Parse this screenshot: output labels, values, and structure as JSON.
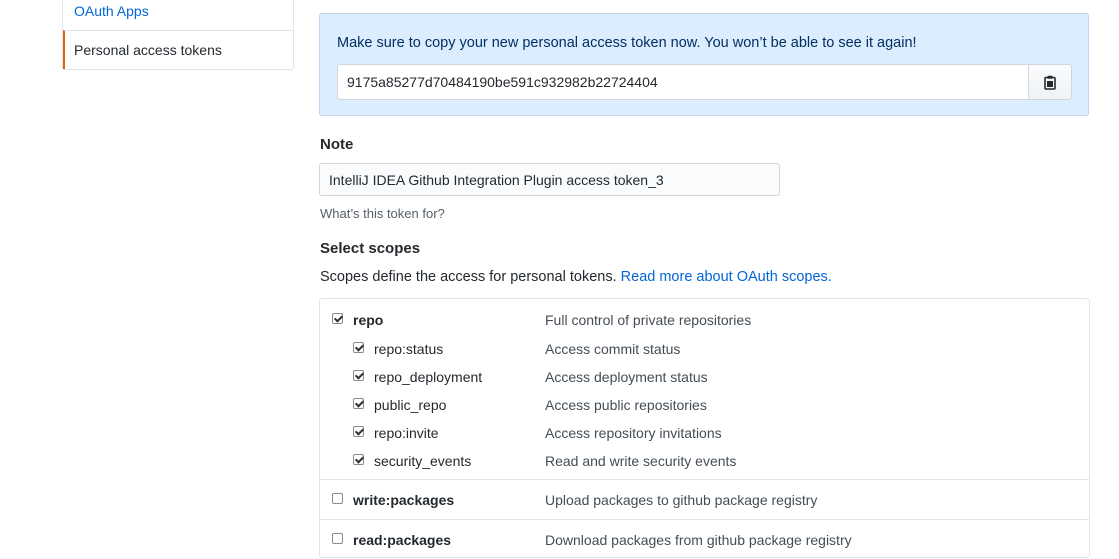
{
  "sidebar": {
    "items": [
      {
        "label": "OAuth Apps"
      },
      {
        "label": "Personal access tokens"
      }
    ]
  },
  "flash": {
    "message": "Make sure to copy your new personal access token now. You won’t be able to see it again!",
    "token": "9175a85277d70484190be591c932982b22724404"
  },
  "note": {
    "label": "Note",
    "value": "IntelliJ IDEA Github Integration Plugin access token_3",
    "hint": "What’s this token for?"
  },
  "scopes": {
    "label": "Select scopes",
    "description": "Scopes define the access for personal tokens.",
    "link": "Read more about OAuth scopes.",
    "items": [
      {
        "name": "repo",
        "desc": "Full control of private repositories",
        "checked": true
      },
      {
        "name": "repo:status",
        "desc": "Access commit status",
        "checked": true
      },
      {
        "name": "repo_deployment",
        "desc": "Access deployment status",
        "checked": true
      },
      {
        "name": "public_repo",
        "desc": "Access public repositories",
        "checked": true
      },
      {
        "name": "repo:invite",
        "desc": "Access repository invitations",
        "checked": true
      },
      {
        "name": "security_events",
        "desc": "Read and write security events",
        "checked": true
      },
      {
        "name": "write:packages",
        "desc": "Upload packages to github package registry",
        "checked": false
      },
      {
        "name": "read:packages",
        "desc": "Download packages from github package registry",
        "checked": false
      }
    ]
  },
  "colors": {
    "link": "#0366d6",
    "flash_bg": "#dbedff",
    "selected_accent": "#e36209"
  }
}
